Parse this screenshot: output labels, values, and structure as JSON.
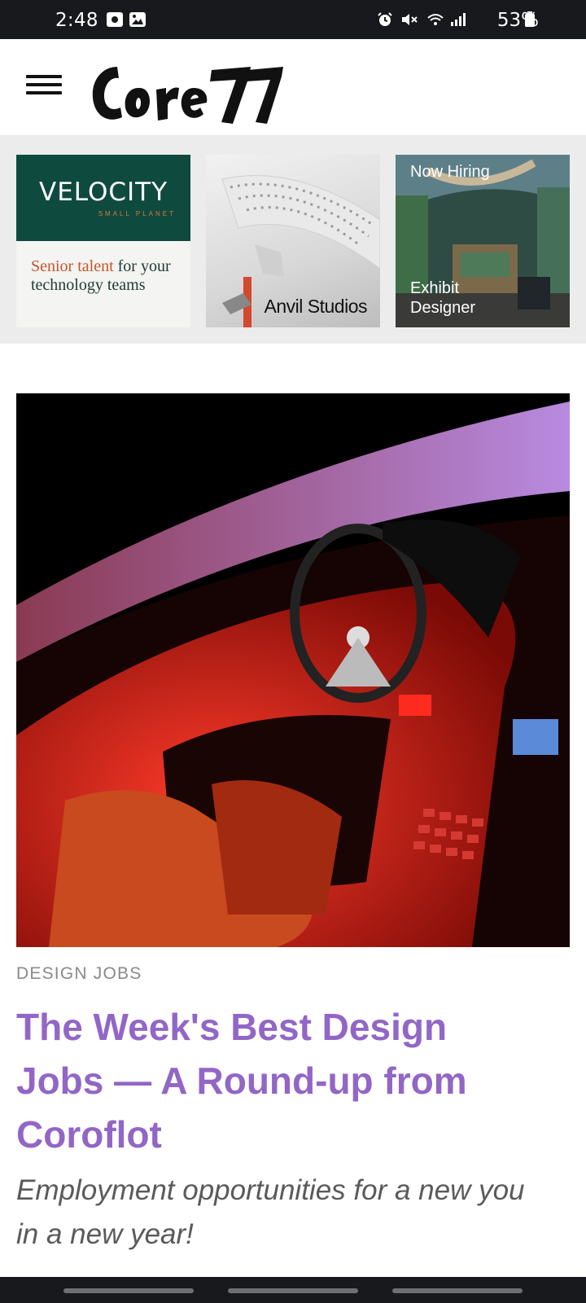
{
  "status_bar": {
    "time": "2:48",
    "battery": "53%"
  },
  "header": {
    "logo_text": "Core77",
    "menu_icon": "hamburger-menu-icon"
  },
  "ads": {
    "velocity": {
      "name": "VELOCITY",
      "sub": "SMALL PLANET",
      "tagline_accent": "Senior talent",
      "tagline_rest": " for your technology teams"
    },
    "anvil": {
      "label": "Anvil Studios"
    },
    "exhibit": {
      "badge": "Now Hiring",
      "title_line1": "Exhibit",
      "title_line2": "Designer"
    }
  },
  "article": {
    "category": "DESIGN JOBS",
    "headline": "The Week's Best Design Jobs — A Round-up from Coroflot",
    "dek": "Employment opportunities for a new you in a new year!"
  },
  "colors": {
    "status_bar": "#17191c",
    "ad_strip": "#ececec",
    "velocity_green": "#0f4a3f",
    "headline_purple": "#9266c6"
  }
}
